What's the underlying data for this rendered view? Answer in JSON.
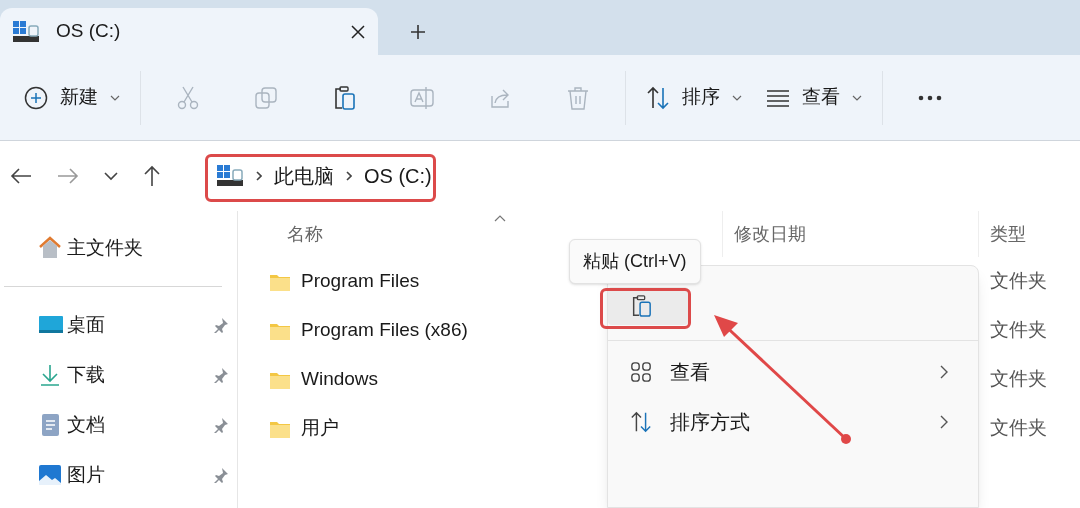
{
  "window": {
    "tab": {
      "title": "OS (C:)",
      "selected": true
    }
  },
  "toolbar": [
    {
      "kind": "new",
      "label": "新建",
      "dropdown": true,
      "disabled": false
    },
    {
      "kind": "cut",
      "disabled": true
    },
    {
      "kind": "copy",
      "disabled": true
    },
    {
      "kind": "paste",
      "disabled": false
    },
    {
      "kind": "rename",
      "disabled": true
    },
    {
      "kind": "share",
      "disabled": true
    },
    {
      "kind": "delete",
      "disabled": true
    },
    {
      "kind": "sort",
      "label": "排序",
      "dropdown": true,
      "disabled": false
    },
    {
      "kind": "view",
      "label": "查看",
      "dropdown": true,
      "disabled": false
    },
    {
      "kind": "more",
      "disabled": false
    }
  ],
  "address_bar": {
    "path": [
      "此电脑",
      "OS (C:)"
    ]
  },
  "sidebar": {
    "items": [
      {
        "kind": "home",
        "label": "主文件夹",
        "pinned": false
      },
      {
        "kind": "desktop",
        "label": "桌面",
        "pinned": true
      },
      {
        "kind": "downloads",
        "label": "下载",
        "pinned": true
      },
      {
        "kind": "documents",
        "label": "文档",
        "pinned": true
      },
      {
        "kind": "pictures",
        "label": "图片",
        "pinned": true
      }
    ]
  },
  "table": {
    "columns": [
      "名称",
      "修改日期",
      "类型"
    ],
    "rows": [
      {
        "name": "Program Files",
        "type": "文件夹"
      },
      {
        "name": "Program Files (x86)",
        "type": "文件夹"
      },
      {
        "name": "Windows",
        "type": "文件夹"
      },
      {
        "name": "用户",
        "type": "文件夹"
      }
    ]
  },
  "context_menu": {
    "tooltip": "粘贴 (Ctrl+V)",
    "items": [
      {
        "kind": "paste",
        "hovered": true
      },
      {
        "kind": "view",
        "label": "查看",
        "submenu": true,
        "hovered": false
      },
      {
        "kind": "sort",
        "label": "排序方式",
        "submenu": true,
        "hovered": false
      }
    ]
  }
}
